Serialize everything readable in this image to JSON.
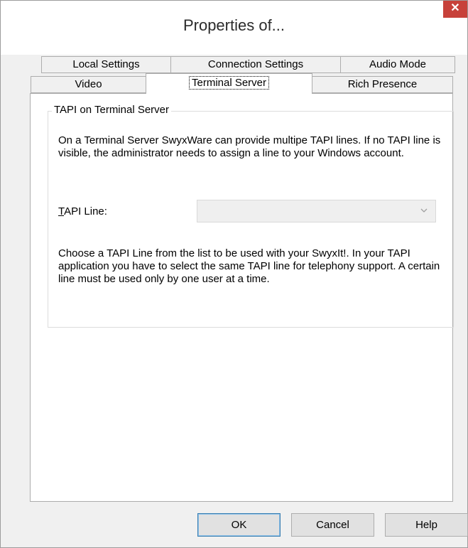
{
  "window": {
    "title": "Properties of...",
    "close_glyph": "✕"
  },
  "tabs": {
    "row1": [
      {
        "label": "Local Settings"
      },
      {
        "label": "Connection Settings"
      },
      {
        "label": "Audio Mode"
      }
    ],
    "row2": [
      {
        "label": "Video"
      },
      {
        "label": "Terminal Server",
        "active": true
      },
      {
        "label": "Rich Presence"
      }
    ]
  },
  "group": {
    "title": "TAPI on Terminal Server",
    "intro_text": "On a Terminal Server SwyxWare can provide multipe TAPI lines. If no TAPI line is visible, the administrator needs to assign a line to your Windows account.",
    "tapi_line_label_mnemonic": "T",
    "tapi_line_label_rest": "API Line:",
    "tapi_line_value": "",
    "help_text": "Choose a TAPI Line from the list to be used with your SwyxIt!. In your TAPI application you have to select the same TAPI line for telephony support. A certain line must be used only by one user at a time."
  },
  "buttons": {
    "ok": "OK",
    "cancel": "Cancel",
    "help": "Help"
  },
  "colors": {
    "close_button": "#c7413a",
    "dialog_bg": "#f0f0f0",
    "panel_bg": "#ffffff",
    "default_button_border": "#3c7fb1"
  },
  "icons": {
    "close": "close-icon",
    "dropdown": "chevron-down-icon"
  }
}
